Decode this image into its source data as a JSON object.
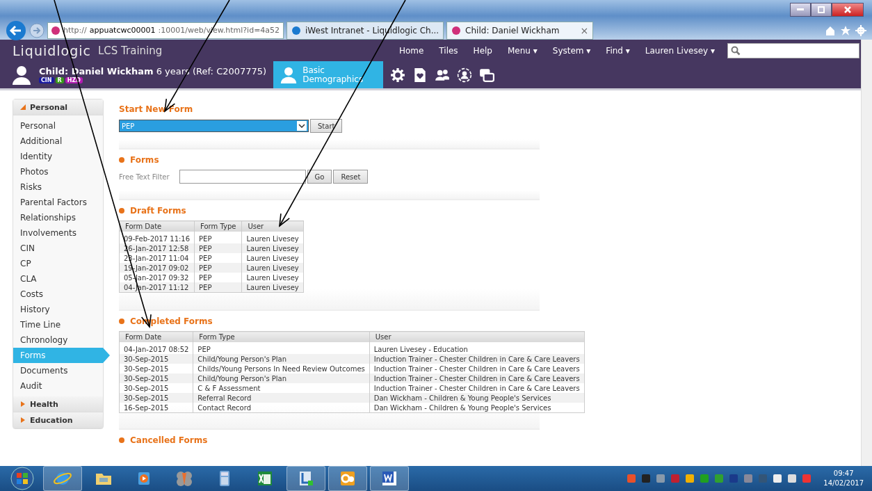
{
  "browser": {
    "address_prefix": "http://",
    "address_host": "appuatcwc00001",
    "address_rest": ":10001/web/view.html?id=4a52",
    "tabs": [
      {
        "title": "iWest Intranet - Liquidlogic Ch...",
        "selected": false
      },
      {
        "title": "Child: Daniel Wickham",
        "selected": true,
        "close": "×"
      }
    ]
  },
  "app": {
    "logo": "Liquidlogic",
    "product": "LCS Training",
    "nav": [
      "Home",
      "Tiles",
      "Help",
      "Menu ▾",
      "System ▾",
      "Find ▾",
      "Lauren Livesey ▾"
    ]
  },
  "child": {
    "name": "Child: Daniel Wickham",
    "detail": "6 years (Ref: C2007775)",
    "badges": [
      {
        "label": "CIN",
        "color": "#1a1aa0"
      },
      {
        "label": "R",
        "color": "#3a9a1a"
      },
      {
        "label": "HZD",
        "color": "#b01ab0"
      }
    ]
  },
  "toolbar": {
    "active_tab": {
      "line1": "Basic",
      "line2": "Demographics",
      "selected": true
    },
    "icons": [
      {
        "kind": "gear"
      },
      {
        "kind": "document"
      },
      {
        "kind": "people"
      },
      {
        "kind": "person-ring"
      },
      {
        "kind": "windows"
      }
    ]
  },
  "sidebar": [
    {
      "label": "Personal",
      "expanded": true,
      "items": [
        {
          "label": "Personal",
          "selected": false
        },
        {
          "label": "Additional",
          "selected": false
        },
        {
          "label": "Identity",
          "selected": false
        },
        {
          "label": "Photos",
          "selected": false
        },
        {
          "label": "Risks",
          "selected": false
        },
        {
          "label": "Parental Factors",
          "selected": false
        },
        {
          "label": "Relationships",
          "selected": false
        },
        {
          "label": "Involvements",
          "selected": false
        },
        {
          "label": "CIN",
          "selected": false
        },
        {
          "label": "CP",
          "selected": false
        },
        {
          "label": "CLA",
          "selected": false
        },
        {
          "label": "Costs",
          "selected": false
        },
        {
          "label": "History",
          "selected": false
        },
        {
          "label": "Time Line",
          "selected": false
        },
        {
          "label": "Chronology",
          "selected": false
        },
        {
          "label": "Forms",
          "selected": true
        },
        {
          "label": "Documents",
          "selected": false
        },
        {
          "label": "Audit",
          "selected": false
        }
      ]
    },
    {
      "label": "Health",
      "expanded": false
    },
    {
      "label": "Education",
      "expanded": false
    }
  ],
  "start_new_form": {
    "title": "Start New Form",
    "value": "PEP",
    "button": "Start"
  },
  "forms": {
    "title": "Forms",
    "filter_label": "Free Text Filter",
    "buttons": [
      "Go",
      "Reset"
    ]
  },
  "draft_forms": {
    "title": "Draft Forms",
    "columns": [
      "Form Date",
      "Form Type",
      "User"
    ],
    "rows": [
      [
        "09-Feb-2017 11:16",
        "PEP",
        "Lauren Livesey"
      ],
      [
        "26-Jan-2017 12:58",
        "PEP",
        "Lauren Livesey"
      ],
      [
        "23-Jan-2017 11:04",
        "PEP",
        "Lauren Livesey"
      ],
      [
        "19-Jan-2017 09:02",
        "PEP",
        "Lauren Livesey"
      ],
      [
        "05-Jan-2017 09:32",
        "PEP",
        "Lauren Livesey"
      ],
      [
        "04-Jan-2017 11:12",
        "PEP",
        "Lauren Livesey"
      ]
    ]
  },
  "completed_forms": {
    "title": "Completed Forms",
    "columns": [
      "Form Date",
      "Form Type",
      "User"
    ],
    "rows": [
      [
        "04-Jan-2017 08:52",
        "PEP",
        "Lauren Livesey - Education"
      ],
      [
        "30-Sep-2015",
        "Child/Young Person's Plan",
        "Induction Trainer - Chester Children in Care & Care Leavers"
      ],
      [
        "30-Sep-2015",
        "Childs/Young Persons In Need Review Outcomes",
        "Induction Trainer - Chester Children in Care & Care Leavers"
      ],
      [
        "30-Sep-2015",
        "Child/Young Person's Plan",
        "Induction Trainer - Chester Children in Care & Care Leavers"
      ],
      [
        "30-Sep-2015",
        "C & F Assessment",
        "Induction Trainer - Chester Children in Care & Care Leavers"
      ],
      [
        "30-Sep-2015",
        "Referral Record",
        "Dan Wickham - Children & Young People's Services"
      ],
      [
        "16-Sep-2015",
        "Contact Record",
        "Dan Wickham - Children & Young People's Services"
      ]
    ]
  },
  "cancelled_forms": {
    "title": "Cancelled Forms"
  },
  "taskbar": {
    "apps": [
      {
        "kind": "browser",
        "selected": true
      },
      {
        "kind": "folder",
        "selected": false
      },
      {
        "kind": "media",
        "selected": false
      },
      {
        "kind": "flower",
        "selected": false
      },
      {
        "kind": "calculator",
        "selected": false
      },
      {
        "kind": "spreadsheet",
        "selected": false
      },
      {
        "kind": "sync",
        "selected": true
      },
      {
        "kind": "mail",
        "selected": true
      },
      {
        "kind": "wordprocessor",
        "selected": true
      }
    ],
    "time": "09:47",
    "date": "14/02/2017"
  }
}
